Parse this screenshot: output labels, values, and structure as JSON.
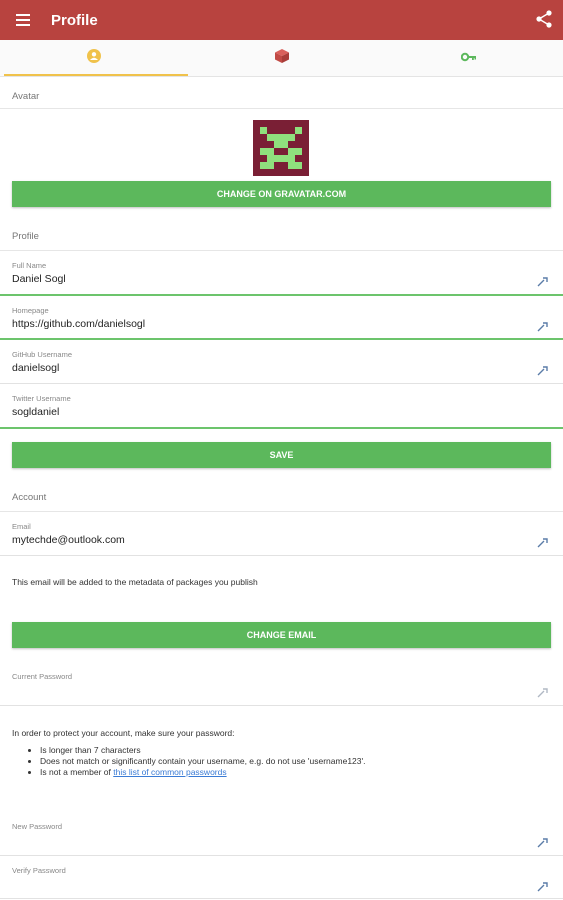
{
  "appbar": {
    "title": "Profile",
    "menu_icon": "menu-icon",
    "share_icon": "share-icon"
  },
  "tabs": [
    {
      "name": "profile",
      "icon": "user-icon",
      "color": "#f0c24b",
      "active": true
    },
    {
      "name": "packages",
      "icon": "package-icon",
      "color": "#c9524d",
      "active": false
    },
    {
      "name": "keys",
      "icon": "key-icon",
      "color": "#5cb85c",
      "active": false
    }
  ],
  "avatar_section": {
    "label": "Avatar",
    "button": "CHANGE ON GRAVATAR.COM"
  },
  "profile_section": {
    "label": "Profile",
    "fields": [
      {
        "label": "Full Name",
        "value": "Daniel Sogl"
      },
      {
        "label": "Homepage",
        "value": "https://github.com/danielsogl"
      },
      {
        "label": "GitHub Username",
        "value": "danielsogl"
      },
      {
        "label": "Twitter Username",
        "value": "sogldaniel"
      }
    ],
    "button": "SAVE"
  },
  "account_section": {
    "label": "Account",
    "email_label": "Email",
    "email_value": "mytechde@outlook.com",
    "email_note": "This email will be added to the metadata of packages you publish",
    "button": "CHANGE EMAIL"
  },
  "password_section": {
    "current_label": "Current Password",
    "intro": "In order to protect your account, make sure your password:",
    "rules": [
      "Is longer than 7 characters",
      "Does not match or significantly contain your username, e.g. do not use 'username123'.",
      "Is not a member of "
    ],
    "rule_link": "this list of common passwords",
    "new_label": "New Password",
    "verify_label": "Verify Password"
  },
  "colors": {
    "appbar": "#b8433f",
    "button": "#5cb85c",
    "focus_line": "#6cc46c",
    "tab_indicator": "#f0c24b"
  }
}
